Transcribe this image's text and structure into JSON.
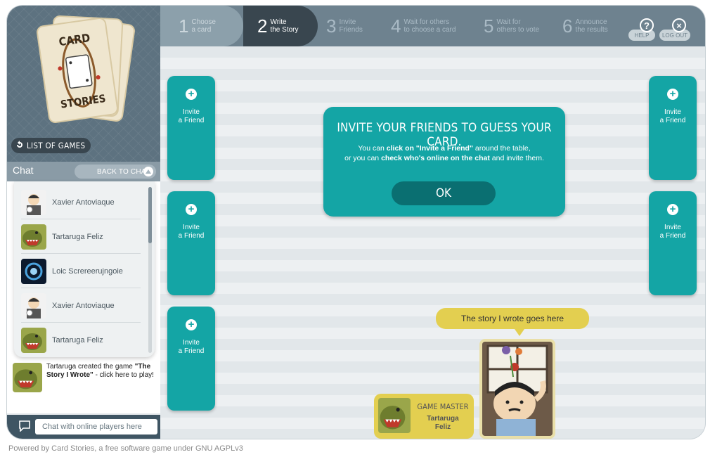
{
  "steps": [
    {
      "num": "1",
      "line1": "Choose",
      "line2": "a card"
    },
    {
      "num": "2",
      "line1": "Write",
      "line2": "the Story"
    },
    {
      "num": "3",
      "line1": "Invite",
      "line2": "Friends"
    },
    {
      "num": "4",
      "line1": "Wait for others",
      "line2": "to choose a card"
    },
    {
      "num": "5",
      "line1": "Wait for",
      "line2": "others to vote"
    },
    {
      "num": "6",
      "line1": "Announce",
      "line2": "the results"
    }
  ],
  "active_step": 2,
  "top_buttons": {
    "help_label": "HELP",
    "logout_label": "LOG OUT",
    "help_icon": "?",
    "logout_icon": "×"
  },
  "logo_text": {
    "line1": "CARD",
    "line2": "STORIES"
  },
  "left": {
    "list_games_label": "LIST OF GAMES"
  },
  "chat": {
    "title": "Chat",
    "back_label": "BACK TO CHAT",
    "players": [
      {
        "name": "Xavier Antoviaque",
        "avatar": "boy-avatar"
      },
      {
        "name": "Tartaruga Feliz",
        "avatar": "dino-avatar"
      },
      {
        "name": "Loic Screreerujngoie",
        "avatar": "space-avatar"
      },
      {
        "name": "Xavier Antoviaque",
        "avatar": "boy-avatar"
      },
      {
        "name": "Tartaruga Feliz",
        "avatar": "dino-avatar"
      }
    ],
    "notice": {
      "prefix": "Tartaruga created the game ",
      "game_name": "\"The Story I Wrote\"",
      "suffix": " - click here to play!"
    },
    "input_placeholder": "Chat with online players here"
  },
  "board": {
    "invite_slot_line1": "Invite",
    "invite_slot_line2": "a Friend",
    "invite_slot_icon": "+",
    "dialog": {
      "title": "INVITE YOUR FRIENDS TO GUESS YOUR CARD.",
      "line1_a": "You can ",
      "line1_b": "click on \"Invite a Friend\"",
      "line1_c": " around the table,",
      "line2_a": "or  you can ",
      "line2_b": "check who's online on the chat",
      "line2_c": " and invite them.",
      "ok_label": "OK"
    },
    "story_text": "The story I wrote goes here",
    "game_master": {
      "label": "GAME MASTER",
      "name_line1": "Tartaruga",
      "name_line2": "Feliz"
    }
  },
  "colors": {
    "teal": "#14a5a5",
    "dark_teal": "#0a6f71",
    "yellow": "#e3cf50",
    "slate": "#6e828f"
  },
  "footer": "Powered by Card Stories, a free software game under GNU AGPLv3"
}
